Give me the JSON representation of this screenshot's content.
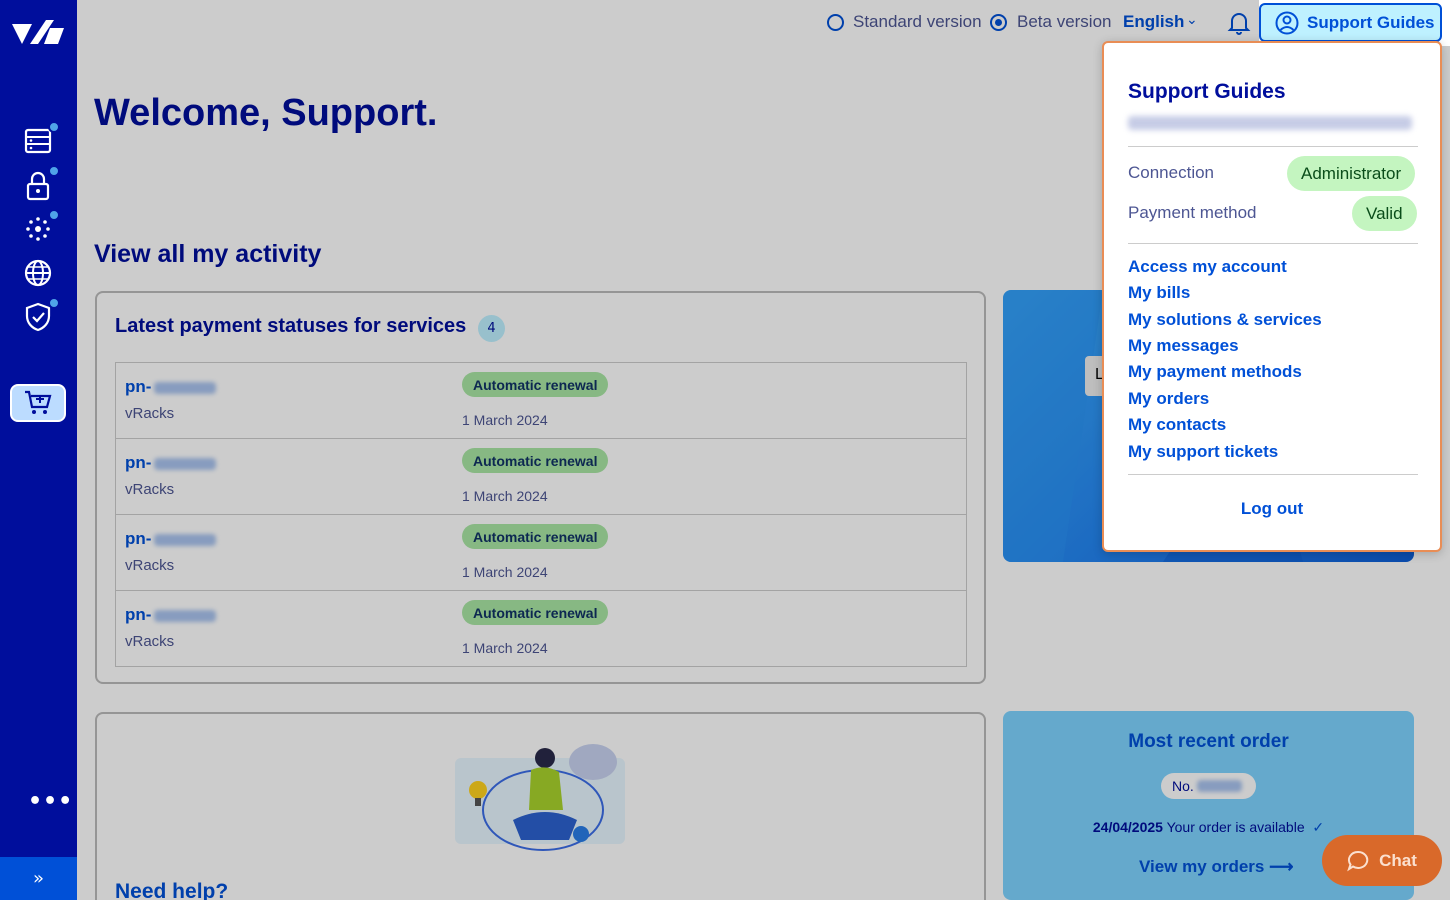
{
  "topbar": {
    "standard_version": "Standard version",
    "beta_version": "Beta version",
    "language": "English",
    "support_guides": "Support Guides"
  },
  "main": {
    "welcome": "Welcome, Support.",
    "activity_title": "View all my activity",
    "payments": {
      "title": "Latest payment statuses for services",
      "count": "4",
      "rows": [
        {
          "id_prefix": "pn-",
          "type": "vRacks",
          "status": "Automatic renewal",
          "date": "1 March 2024"
        },
        {
          "id_prefix": "pn-",
          "type": "vRacks",
          "status": "Automatic renewal",
          "date": "1 March 2024"
        },
        {
          "id_prefix": "pn-",
          "type": "vRacks",
          "status": "Automatic renewal",
          "date": "1 March 2024"
        },
        {
          "id_prefix": "pn-",
          "type": "vRacks",
          "status": "Automatic renewal",
          "date": "1 March 2024"
        }
      ]
    },
    "promo_button_initial": "L",
    "help_title": "Need help?",
    "order": {
      "title": "Most recent order",
      "number_prefix": "No.",
      "date": "24/04/2025",
      "status": "Your order is available",
      "link": "View my orders"
    }
  },
  "dropdown": {
    "title": "Support Guides",
    "connection_label": "Connection",
    "connection_value": "Administrator",
    "payment_label": "Payment method",
    "payment_value": "Valid",
    "links": [
      "Access my account",
      "My bills",
      "My solutions & services",
      "My messages",
      "My payment methods",
      "My orders",
      "My contacts",
      "My support tickets"
    ],
    "logout": "Log out"
  },
  "chat": {
    "label": "Chat"
  },
  "colors": {
    "sidebar": "#000e9c",
    "accent": "#0050d7",
    "badge_green": "#a9e6a4",
    "chat": "#d9692a",
    "dropdown_border": "#e98d55"
  },
  "icons": {
    "sidebar": [
      "server-icon",
      "lock-icon",
      "network-icon",
      "globe-icon",
      "shield-check-icon",
      "cart-plus-icon"
    ],
    "topbar": [
      "bell-icon",
      "user-circle-icon",
      "chevron-down-icon"
    ]
  }
}
